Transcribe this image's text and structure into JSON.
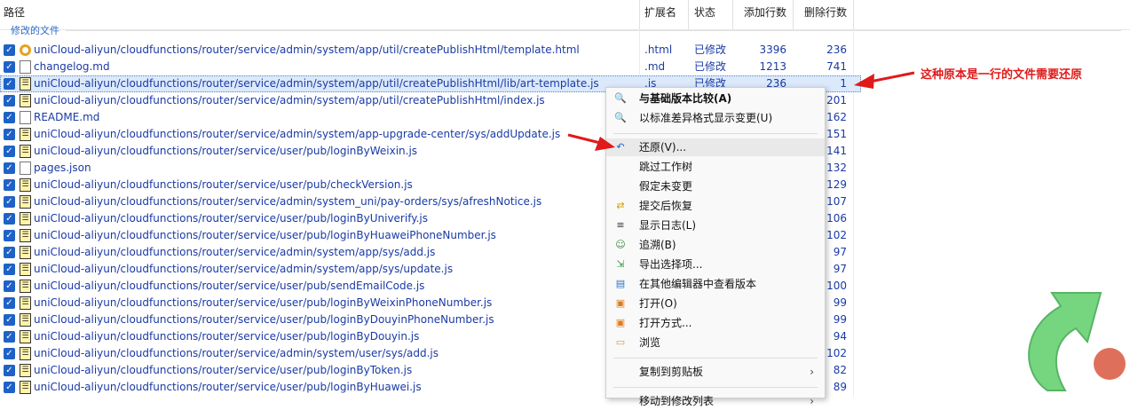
{
  "header": {
    "path": "路径",
    "ext": "扩展名",
    "status": "状态",
    "added": "添加行数",
    "deleted": "删除行数"
  },
  "group_label": "修改的文件",
  "files": [
    {
      "path": "uniCloud-aliyun/cloudfunctions/router/service/admin/system/app/util/createPublishHtml/template.html",
      "ext": ".html",
      "status": "已修改",
      "added": "3396",
      "deleted": "236",
      "icon": "html"
    },
    {
      "path": "changelog.md",
      "ext": ".md",
      "status": "已修改",
      "added": "1213",
      "deleted": "741",
      "icon": "doc"
    },
    {
      "path": "uniCloud-aliyun/cloudfunctions/router/service/admin/system/app/util/createPublishHtml/lib/art-template.js",
      "ext": ".js",
      "status": "已修改",
      "added": "236",
      "deleted": "1",
      "icon": "js",
      "selected": true
    },
    {
      "path": "uniCloud-aliyun/cloudfunctions/router/service/admin/system/app/util/createPublishHtml/index.js",
      "ext": "",
      "status": "",
      "added": "",
      "deleted": "201",
      "icon": "js"
    },
    {
      "path": "README.md",
      "ext": "",
      "status": "",
      "added": "",
      "deleted": "162",
      "icon": "doc"
    },
    {
      "path": "uniCloud-aliyun/cloudfunctions/router/service/admin/system/app-upgrade-center/sys/addUpdate.js",
      "ext": "",
      "status": "",
      "added": "",
      "deleted": "151",
      "icon": "js"
    },
    {
      "path": "uniCloud-aliyun/cloudfunctions/router/service/user/pub/loginByWeixin.js",
      "ext": "",
      "status": "",
      "added": "",
      "deleted": "141",
      "icon": "js"
    },
    {
      "path": "pages.json",
      "ext": "",
      "status": "",
      "added": "",
      "deleted": "132",
      "icon": "doc"
    },
    {
      "path": "uniCloud-aliyun/cloudfunctions/router/service/user/pub/checkVersion.js",
      "ext": "",
      "status": "",
      "added": "",
      "deleted": "129",
      "icon": "js"
    },
    {
      "path": "uniCloud-aliyun/cloudfunctions/router/service/admin/system_uni/pay-orders/sys/afreshNotice.js",
      "ext": "",
      "status": "",
      "added": "",
      "deleted": "107",
      "icon": "js"
    },
    {
      "path": "uniCloud-aliyun/cloudfunctions/router/service/user/pub/loginByUniverify.js",
      "ext": "",
      "status": "",
      "added": "",
      "deleted": "106",
      "icon": "js"
    },
    {
      "path": "uniCloud-aliyun/cloudfunctions/router/service/user/pub/loginByHuaweiPhoneNumber.js",
      "ext": "",
      "status": "",
      "added": "",
      "deleted": "102",
      "icon": "js"
    },
    {
      "path": "uniCloud-aliyun/cloudfunctions/router/service/admin/system/app/sys/add.js",
      "ext": "",
      "status": "",
      "added": "",
      "deleted": "97",
      "icon": "js"
    },
    {
      "path": "uniCloud-aliyun/cloudfunctions/router/service/admin/system/app/sys/update.js",
      "ext": "",
      "status": "",
      "added": "",
      "deleted": "97",
      "icon": "js"
    },
    {
      "path": "uniCloud-aliyun/cloudfunctions/router/service/user/pub/sendEmailCode.js",
      "ext": "",
      "status": "",
      "added": "",
      "deleted": "100",
      "icon": "js"
    },
    {
      "path": "uniCloud-aliyun/cloudfunctions/router/service/user/pub/loginByWeixinPhoneNumber.js",
      "ext": "",
      "status": "",
      "added": "",
      "deleted": "99",
      "icon": "js"
    },
    {
      "path": "uniCloud-aliyun/cloudfunctions/router/service/user/pub/loginByDouyinPhoneNumber.js",
      "ext": "",
      "status": "",
      "added": "",
      "deleted": "99",
      "icon": "js"
    },
    {
      "path": "uniCloud-aliyun/cloudfunctions/router/service/user/pub/loginByDouyin.js",
      "ext": "",
      "status": "",
      "added": "",
      "deleted": "94",
      "icon": "js"
    },
    {
      "path": "uniCloud-aliyun/cloudfunctions/router/service/admin/system/user/sys/add.js",
      "ext": "",
      "status": "",
      "added": "",
      "deleted": "102",
      "icon": "js"
    },
    {
      "path": "uniCloud-aliyun/cloudfunctions/router/service/user/pub/loginByToken.js",
      "ext": "",
      "status": "",
      "added": "",
      "deleted": "82",
      "icon": "js"
    },
    {
      "path": "uniCloud-aliyun/cloudfunctions/router/service/user/pub/loginByHuawei.js",
      "ext": "",
      "status": "",
      "added": "",
      "deleted": "89",
      "icon": "js"
    }
  ],
  "menu": [
    {
      "label": "与基础版本比较(A)",
      "icon": "magnifier-icon",
      "bold": true
    },
    {
      "label": "以标准差异格式显示变更(U)",
      "icon": "magnifier-icon"
    },
    {
      "sep": true
    },
    {
      "label": "还原(V)...",
      "icon": "revert-icon",
      "highlight": true
    },
    {
      "label": "跳过工作树",
      "icon": ""
    },
    {
      "label": "假定未变更",
      "icon": ""
    },
    {
      "label": "提交后恢复",
      "icon": "restore-icon"
    },
    {
      "label": "显示日志(L)",
      "icon": "log-icon"
    },
    {
      "label": "追溯(B)",
      "icon": "blame-icon"
    },
    {
      "label": "导出选择项...",
      "icon": "export-icon"
    },
    {
      "label": "在其他编辑器中查看版本",
      "icon": "editor-icon"
    },
    {
      "label": "打开(O)",
      "icon": "open-icon"
    },
    {
      "label": "打开方式...",
      "icon": "openwith-icon"
    },
    {
      "label": "浏览",
      "icon": "folder-icon"
    },
    {
      "sep": true
    },
    {
      "label": "复制到剪贴板",
      "icon": "",
      "submenu": true
    },
    {
      "sep": true
    },
    {
      "label": "移动到修改列表",
      "icon": "",
      "submenu": true
    }
  ],
  "annotation": "这种原本是一行的文件需要还原",
  "colors": {
    "accent": "#1f62c7",
    "annotation": "#e01a1a"
  }
}
